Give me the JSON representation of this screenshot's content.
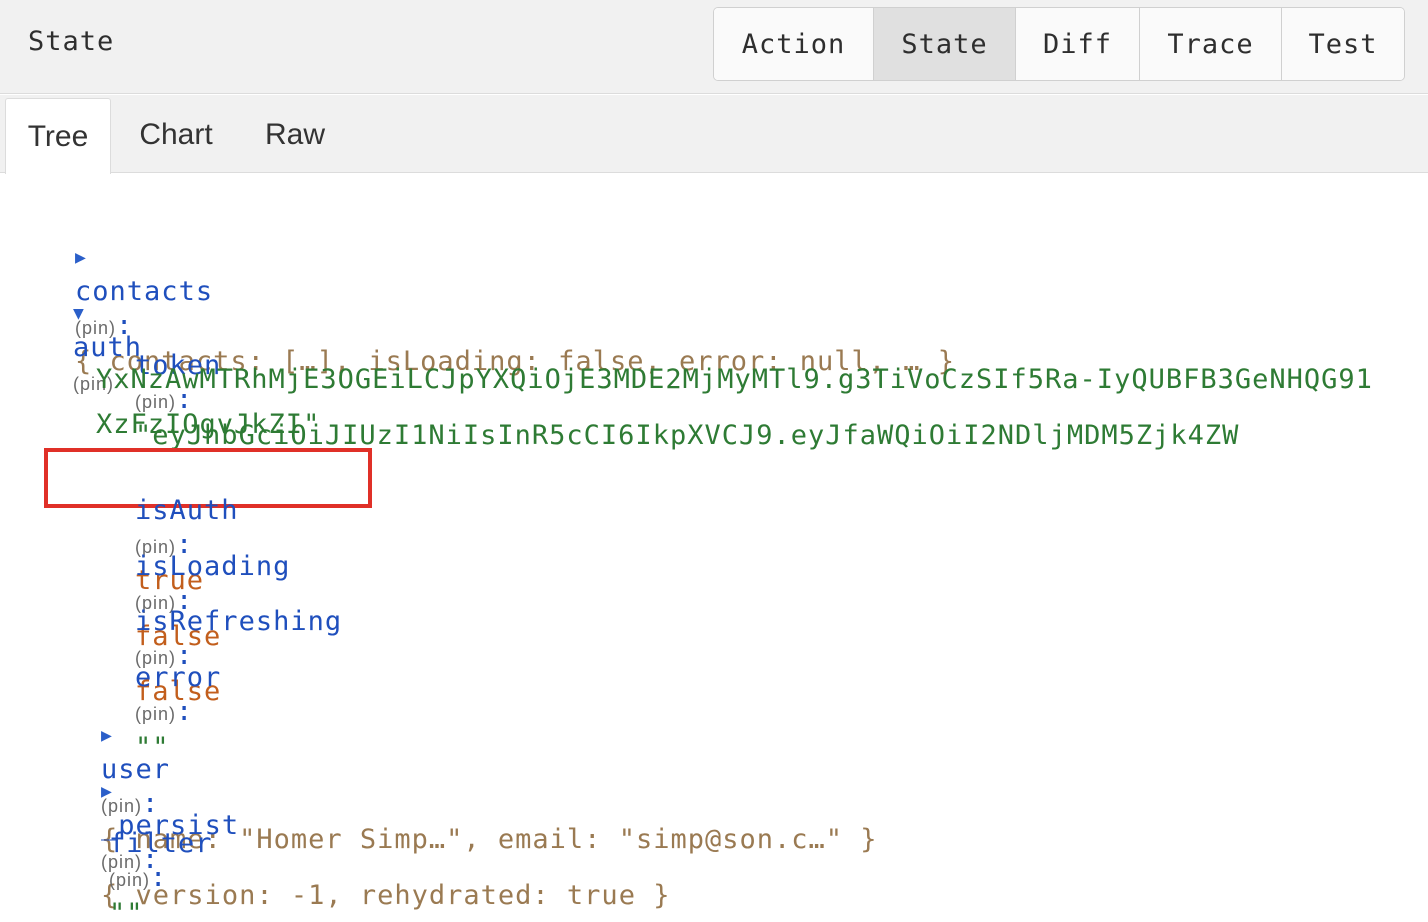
{
  "header": {
    "title": "State",
    "monitor_tabs": [
      "Action",
      "State",
      "Diff",
      "Trace",
      "Test"
    ],
    "active_monitor_tab": "State"
  },
  "subtabs": {
    "items": [
      "Tree",
      "Chart",
      "Raw"
    ],
    "active": "Tree"
  },
  "tree": {
    "pin_label": "(pin)",
    "colon": ":",
    "contacts": {
      "key": "contacts",
      "expanded": false,
      "preview": "{ contacts: […], isLoading: false, error: null, … }"
    },
    "auth": {
      "key": "auth",
      "expanded": true,
      "token": {
        "key": "token",
        "value_line1": "\"eyJhbGciOiJIUzI1NiIsInR5cCI6IkpXVCJ9.eyJfaWQiOiI2NDljMDM5Zjk4ZW",
        "value_line2": "YxNzAwMTRhMjE3OGEiLCJpYXQiOjE3MDE2MjMyMTl9.g3TiVoCzSIf5Ra-IyQUBFB3GeNHQG91",
        "value_line3": "XzFzIOgvJkZI\""
      },
      "isAuth": {
        "key": "isAuth",
        "value": "true"
      },
      "isLoading": {
        "key": "isLoading",
        "value": "false"
      },
      "isRefreshing": {
        "key": "isRefreshing",
        "value": "false"
      },
      "error": {
        "key": "error",
        "value": "\"\""
      },
      "user": {
        "key": "user",
        "expanded": false,
        "preview": "{ name: \"Homer Simp…\", email: \"simp@son.c…\" }"
      },
      "_persist": {
        "key": "_persist",
        "expanded": false,
        "preview": "{ version: -1, rehydrated: true }"
      }
    },
    "filter": {
      "key": "filter",
      "value": "\"\""
    }
  },
  "icons": {
    "collapsed": "triangle-right-icon",
    "expanded": "triangle-down-icon"
  },
  "colors": {
    "key": "#1f4fbd",
    "string": "#2e7b34",
    "boolean": "#c25e1c",
    "preview": "#9a7a52",
    "highlight": "#e03028"
  }
}
